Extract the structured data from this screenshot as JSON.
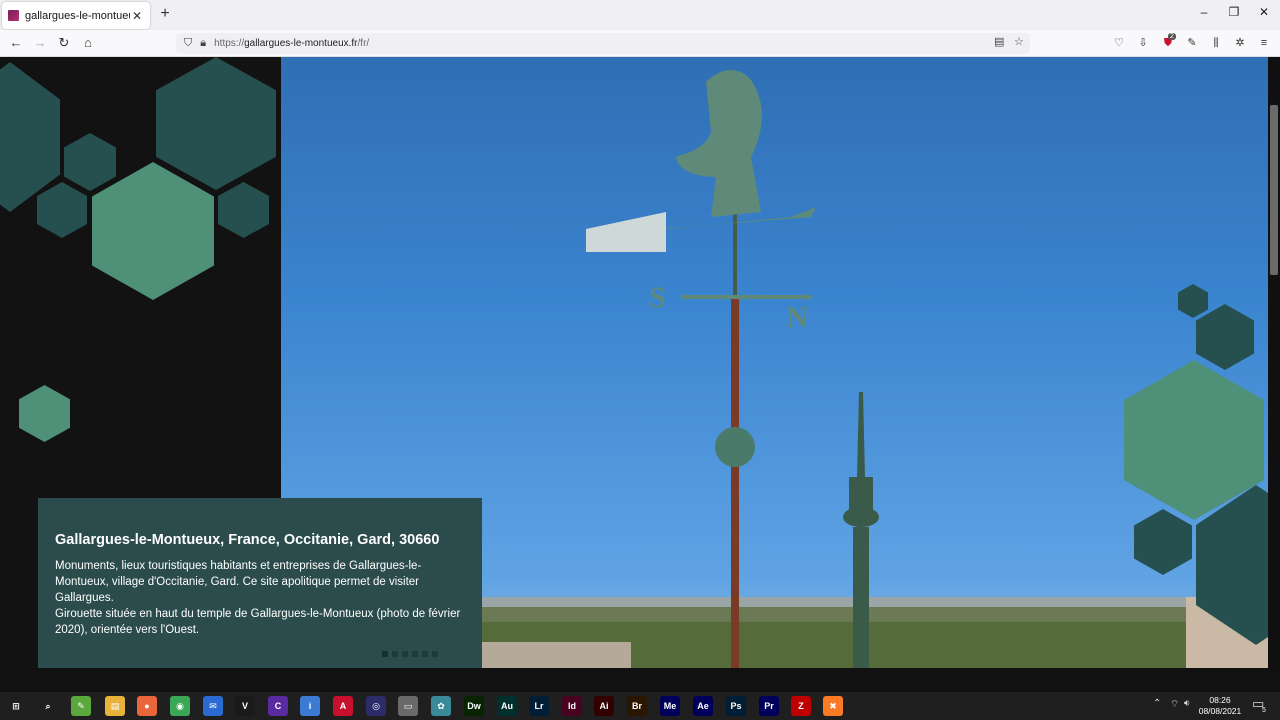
{
  "browser": {
    "tab_title": "gallargues-le-montueux.fr",
    "tab_close": "✕",
    "new_tab": "+",
    "url_scheme": "https://",
    "url_host": "gallargues-le-montueux.fr",
    "url_path": "/fr/",
    "window_controls": [
      "–",
      "❐",
      "✕"
    ],
    "extension_badge": "2"
  },
  "hero": {
    "title": "Gallargues-le-Montueux, France, Occitanie, Gard, 30660",
    "description": "Monuments, lieux touristiques habitants et entreprises de Gallargues-le-Montueux, village d'Occitanie, Gard. Ce site apolitique permet de visiter Gallargues.",
    "photo_caption": "Girouette située en haut du temple de Gallargues-le-Montueux (photo de février 2020), orientée vers l'Ouest.",
    "slide_count": 6,
    "active_slide": 1,
    "colors": {
      "hex_light": "#4f9079",
      "hex_dark": "#26504f",
      "caption_bg": "#2b4b4c",
      "sky": "#3b84cf"
    }
  },
  "taskbar": {
    "time": "08:26",
    "date": "08/08/2021",
    "notification_count": "5",
    "apps": [
      {
        "name": "windows-start-icon",
        "label": "⊞",
        "color": "#1f1f1f"
      },
      {
        "name": "search-icon",
        "label": "⌕",
        "color": "#1f1f1f"
      },
      {
        "name": "notepad-icon",
        "label": "✎",
        "color": "#5aa83c"
      },
      {
        "name": "file-explorer-icon",
        "label": "▤",
        "color": "#e8b33a"
      },
      {
        "name": "firefox-icon",
        "label": "●",
        "color": "#e8663a"
      },
      {
        "name": "chrome-icon",
        "label": "◉",
        "color": "#3aa757"
      },
      {
        "name": "thunderbird-icon",
        "label": "✉",
        "color": "#2b6bd1"
      },
      {
        "name": "vim-icon",
        "label": "V",
        "color": "#1a1a1a"
      },
      {
        "name": "app-icon",
        "label": "C",
        "color": "#5a2aa0"
      },
      {
        "name": "info-icon",
        "label": "i",
        "color": "#3b7bd6"
      },
      {
        "name": "acrobat-icon",
        "label": "A",
        "color": "#c8102e"
      },
      {
        "name": "disc-icon",
        "label": "◎",
        "color": "#2c2c6a"
      },
      {
        "name": "card-icon",
        "label": "▭",
        "color": "#6a6a6a"
      },
      {
        "name": "photo-tool-icon",
        "label": "✿",
        "color": "#3a8a9a"
      },
      {
        "name": "dreamweaver-icon",
        "label": "Dw",
        "color": "#072401"
      },
      {
        "name": "audition-icon",
        "label": "Au",
        "color": "#00302e"
      },
      {
        "name": "lightroom-icon",
        "label": "Lr",
        "color": "#001e36"
      },
      {
        "name": "indesign-icon",
        "label": "Id",
        "color": "#49021f"
      },
      {
        "name": "illustrator-icon",
        "label": "Ai",
        "color": "#330000"
      },
      {
        "name": "bridge-icon",
        "label": "Br",
        "color": "#2b1700"
      },
      {
        "name": "media-encoder-icon",
        "label": "Me",
        "color": "#00005b"
      },
      {
        "name": "after-effects-icon",
        "label": "Ae",
        "color": "#00005b"
      },
      {
        "name": "photoshop-icon",
        "label": "Ps",
        "color": "#001e36"
      },
      {
        "name": "premiere-icon",
        "label": "Pr",
        "color": "#00005b"
      },
      {
        "name": "filezilla-icon",
        "label": "Z",
        "color": "#bf0000"
      },
      {
        "name": "xampp-icon",
        "label": "✖",
        "color": "#fb7a24"
      }
    ]
  }
}
